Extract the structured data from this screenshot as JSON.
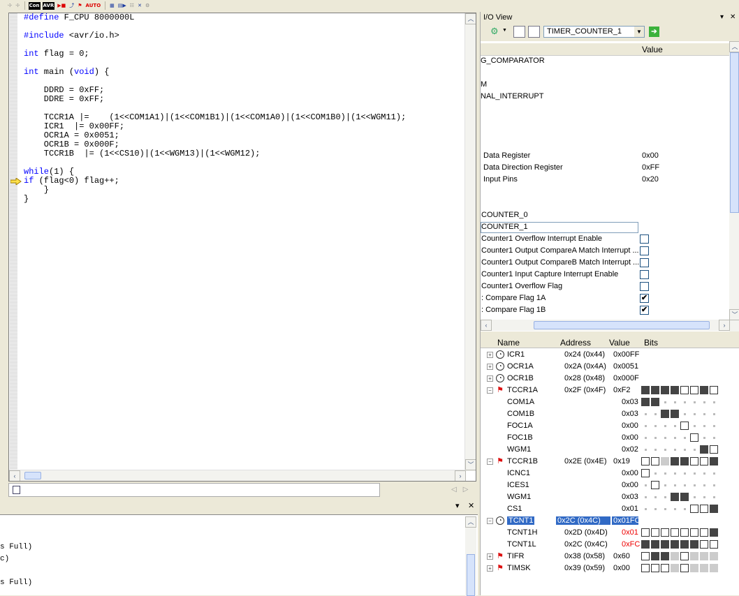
{
  "toolbar": {
    "items": [
      "☩",
      "☩",
      "Con",
      "AVR",
      "▶■",
      "⤴",
      "⚑",
      "AUTO",
      "▦",
      "▤▶",
      "☷",
      "✕",
      "⚙"
    ]
  },
  "editor": {
    "lines": [
      "#define F_CPU 8000000L",
      "",
      "#include <avr/io.h>",
      "",
      "int flag = 0;",
      "",
      "int main (void) {",
      "",
      "    DDRD = 0xFF;",
      "    DDRE = 0xFF;",
      "",
      "    TCCR1A |=    (1<<COM1A1)|(1<<COM1B1)|(1<<COM1A0)|(1<<COM1B0)|(1<<WGM11);",
      "    ICR1  |= 0x00FF;",
      "    OCR1A = 0x0051;",
      "    OCR1B = 0x000F;",
      "    TCCR1B  |= (1<<CS10)|(1<<WGM13)|(1<<WGM12);",
      "",
      "while(1) {",
      "if (flag<0) flag++;",
      "    }",
      "}"
    ]
  },
  "output": {
    "lines": [
      "s Full)",
      "c)",
      "",
      "s Full)"
    ]
  },
  "io_view": {
    "title": "I/O View",
    "selected_module": "TIMER_COUNTER_1",
    "upper_header": {
      "value": "Value"
    },
    "upper_rows": [
      {
        "name": "G_COMPARATOR",
        "value": ""
      },
      {
        "name": "M",
        "value": ""
      },
      {
        "name": "NAL_INTERRUPT",
        "value": ""
      },
      {
        "name": "Data Register",
        "value": "0x00"
      },
      {
        "name": "Data Direction Register",
        "value": "0xFF"
      },
      {
        "name": "Input Pins",
        "value": "0x20"
      },
      {
        "name": "COUNTER_0",
        "value": ""
      },
      {
        "name": "COUNTER_1",
        "value": ""
      }
    ],
    "check_rows": [
      {
        "name": "Counter1 Overflow Interrupt Enable",
        "checked": false
      },
      {
        "name": "Counter1 Output CompareA Match Interrupt ...",
        "checked": false
      },
      {
        "name": "Counter1 Output CompareB Match Interrupt ...",
        "checked": false
      },
      {
        "name": "Counter1 Input Capture Interrupt Enable",
        "checked": false
      },
      {
        "name": "Counter1 Overflow Flag",
        "checked": false
      },
      {
        "name": ": Compare Flag 1A",
        "checked": true
      },
      {
        "name": ": Compare Flag 1B",
        "checked": true
      }
    ],
    "lower_header": {
      "name": "Name",
      "address": "Address",
      "value": "Value",
      "bits": "Bits"
    },
    "registers": [
      {
        "name": "ICR1",
        "address": "0x24 (0x44)",
        "value": "0x00FF",
        "level": 0,
        "icon": "clock-icon",
        "exp": "+"
      },
      {
        "name": "OCR1A",
        "address": "0x2A (0x4A)",
        "value": "0x0051",
        "level": 0,
        "icon": "clock-icon",
        "exp": "+"
      },
      {
        "name": "OCR1B",
        "address": "0x28 (0x48)",
        "value": "0x000F",
        "level": 0,
        "icon": "clock-icon",
        "exp": "+"
      },
      {
        "name": "TCCR1A",
        "address": "0x2F (0x4F)",
        "value": "0xF2",
        "level": 0,
        "icon": "flag-icon",
        "exp": "−",
        "bits": "11110010"
      },
      {
        "name": "COM1A",
        "address": "",
        "value": "0x03",
        "level": 1,
        "bits": "11......"
      },
      {
        "name": "COM1B",
        "address": "",
        "value": "0x03",
        "level": 1,
        "bits": "..11...."
      },
      {
        "name": "FOC1A",
        "address": "",
        "value": "0x00",
        "level": 1,
        "bits": "....0..."
      },
      {
        "name": "FOC1B",
        "address": "",
        "value": "0x00",
        "level": 1,
        "bits": ".....0.."
      },
      {
        "name": "WGM1",
        "address": "",
        "value": "0x02",
        "level": 1,
        "bits": "......10"
      },
      {
        "name": "TCCR1B",
        "address": "0x2E (0x4E)",
        "value": "0x19",
        "level": 0,
        "icon": "flag-icon",
        "exp": "−",
        "bits": "00g11001"
      },
      {
        "name": "ICNC1",
        "address": "",
        "value": "0x00",
        "level": 1,
        "bits": "0......."
      },
      {
        "name": "ICES1",
        "address": "",
        "value": "0x00",
        "level": 1,
        "bits": ".0......"
      },
      {
        "name": "WGM1",
        "address": "",
        "value": "0x03",
        "level": 1,
        "bits": "...11..."
      },
      {
        "name": "CS1",
        "address": "",
        "value": "0x01",
        "level": 1,
        "bits": ".....001"
      },
      {
        "name": "TCNT1",
        "address": "0x2C (0x4C)",
        "value": "0x01FC",
        "level": 0,
        "icon": "clock-icon",
        "exp": "−",
        "selected": true
      },
      {
        "name": "TCNT1H",
        "address": "0x2D (0x4D)",
        "value": "0x01",
        "level": 1,
        "red": true,
        "bits": "00000001"
      },
      {
        "name": "TCNT1L",
        "address": "0x2C (0x4C)",
        "value": "0xFC",
        "level": 1,
        "red": true,
        "bits": "11111100"
      },
      {
        "name": "TIFR",
        "address": "0x38 (0x58)",
        "value": "0x60",
        "level": 0,
        "icon": "flag-icon",
        "exp": "+",
        "bits": "011g0ggg"
      },
      {
        "name": "TIMSK",
        "address": "0x39 (0x59)",
        "value": "0x00",
        "level": 0,
        "icon": "flag-icon",
        "exp": "+",
        "bits": "000g0ggg"
      }
    ]
  }
}
